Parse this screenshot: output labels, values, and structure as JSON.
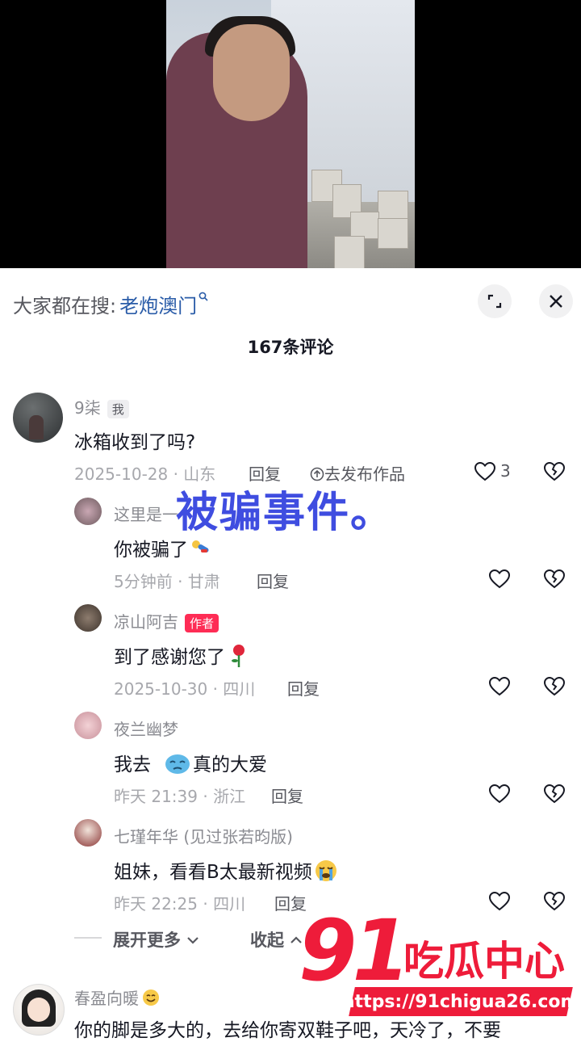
{
  "search": {
    "prefix": "大家都在搜:",
    "term": "老炮澳门"
  },
  "comments_count": "167条评论",
  "comments": [
    {
      "name": "9柒",
      "tag": "我",
      "text": "冰箱收到了吗?",
      "meta": "2025-10-28 · 山东",
      "reply": "回复",
      "publish": "去发布作品",
      "likes": "3"
    },
    {
      "name": "这里是一",
      "text": "你被骗了",
      "meta": "5分钟前 · 甘肃",
      "reply": "回复"
    },
    {
      "name": "凉山阿吉",
      "tag": "作者",
      "text": "到了感谢您了",
      "meta": "2025-10-30 · 四川",
      "reply": "回复"
    },
    {
      "name": "夜兰幽梦",
      "text": "我去",
      "text2": "真的大爱",
      "meta": "昨天 21:39 · 浙江",
      "reply": "回复"
    },
    {
      "name": "七瑾年华 (见过张若昀版)",
      "text": "姐妹，看看B太最新视频",
      "meta": "昨天 22:25 · 四川",
      "reply": "回复"
    },
    {
      "name": "春盈向暖",
      "text": "你的脚是多大的，去给你寄双鞋子吧，天冷了，不要"
    }
  ],
  "expand_label": "展开更多",
  "collapse_label": "收起",
  "overlay_caption": "被骗事件。",
  "watermark": {
    "number": "91",
    "text": "吃瓜中心",
    "url": "https://91chigua26.com"
  },
  "colors": {
    "author_tag": "#fe2c55",
    "search_link": "#2a5ca8",
    "caption": "#3f4de0",
    "watermark": "#ee1c3a"
  }
}
